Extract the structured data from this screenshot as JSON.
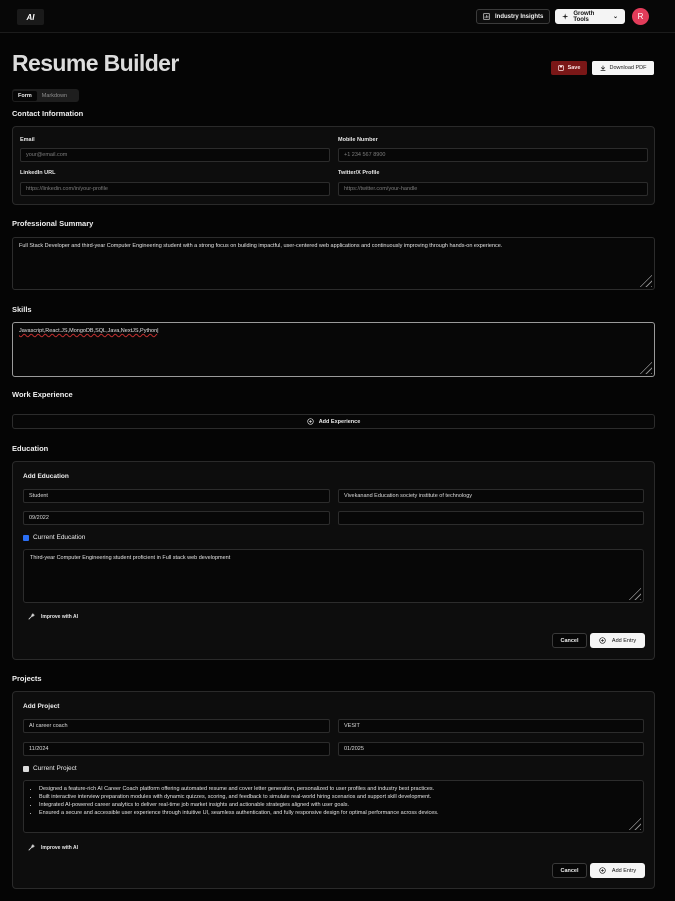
{
  "header": {
    "logo_text": "AI",
    "industry_insights": "Industry Insights",
    "growth_tools": "Growth Tools",
    "avatar_initial": "R",
    "avatar_color": "#e23c5a"
  },
  "page": {
    "title": "Resume Builder",
    "save_label": "Save",
    "download_label": "Download PDF",
    "tabs": [
      "Form",
      "Markdown"
    ],
    "active_tab": "Form"
  },
  "contact": {
    "section_title": "Contact Information",
    "email_label": "Email",
    "email_placeholder": "your@email.com",
    "mobile_label": "Mobile Number",
    "mobile_placeholder": "+1 234 567 8900",
    "linkedin_label": "LinkedIn URL",
    "linkedin_placeholder": "https://linkedin.com/in/your-profile",
    "twitter_label": "Twitter/X Profile",
    "twitter_placeholder": "https://twitter.com/your-handle"
  },
  "summary": {
    "section_title": "Professional Summary",
    "value": "Full Stack Developer and third-year Computer Engineering student with a strong focus on building impactful, user-centered web applications and continuously improving through hands-on experience."
  },
  "skills": {
    "section_title": "Skills",
    "value": "Javascript,React.JS,MongoDB,SQL,Java,NextJS,Python"
  },
  "work": {
    "section_title": "Work Experience",
    "add_label": "Add Experience"
  },
  "education": {
    "section_title": "Education",
    "card_title": "Add Education",
    "title_value": "Student",
    "org_value": "Vivekanand Education society institute of technology",
    "start_value": "09/2022",
    "end_value": "",
    "current_label": "Current Education",
    "current_checked": true,
    "description": "Third-year Computer Engineering student  proficient in Full stack web development",
    "improve_label": "Improve with AI",
    "cancel_label": "Cancel",
    "add_entry_label": "Add Entry"
  },
  "projects": {
    "section_title": "Projects",
    "card_title": "Add Project",
    "title_value": "AI career coach",
    "org_value": "VESIT",
    "start_value": "11/2024",
    "end_value": "01/2025",
    "current_label": "Current Project",
    "current_checked": false,
    "bullets": [
      "Designed a feature-rich AI Career Coach platform offering automated resume and cover letter generation, personalized to user profiles and industry best practices.",
      "Built interactive interview preparation modules with dynamic quizzes, scoring, and feedback to simulate real-world hiring scenarios and support skill development.",
      "Integrated AI-powered career analytics to deliver real-time job market insights and actionable strategies aligned with user goals.",
      "Ensured a secure and accessible user experience through intuitive UI, seamless authentication, and fully responsive design for optimal performance across devices."
    ],
    "improve_label": "Improve with AI",
    "cancel_label": "Cancel",
    "add_entry_label": "Add Entry"
  }
}
